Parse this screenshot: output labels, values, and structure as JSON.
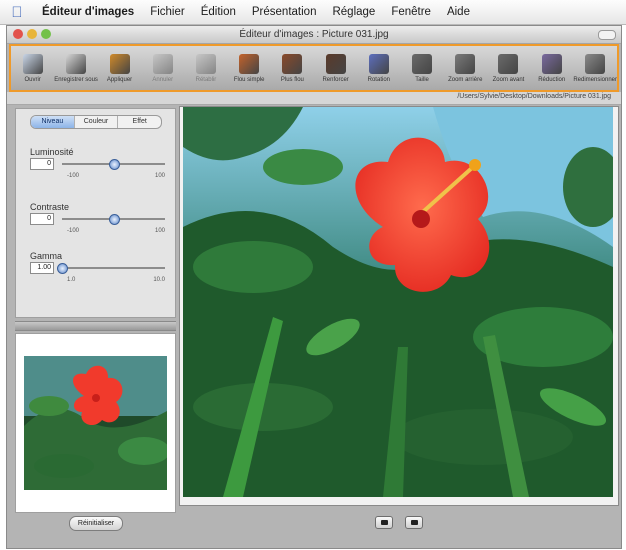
{
  "menubar": {
    "app": "Éditeur d'images",
    "items": [
      "Fichier",
      "Édition",
      "Présentation",
      "Réglage",
      "Fenêtre",
      "Aide"
    ]
  },
  "window": {
    "title": "Éditeur d'images : Picture 031.jpg"
  },
  "toolbar": [
    {
      "label": "Ouvrir",
      "icon": "open-icon",
      "enabled": true
    },
    {
      "label": "Enregistrer sous",
      "icon": "save-icon",
      "enabled": true
    },
    {
      "label": "Appliquer",
      "icon": "apply-icon",
      "enabled": true
    },
    {
      "label": "Annuler",
      "icon": "undo-icon",
      "enabled": false
    },
    {
      "label": "Rétablir",
      "icon": "redo-icon",
      "enabled": false
    },
    {
      "label": "Flou simple",
      "icon": "blur-icon",
      "enabled": true
    },
    {
      "label": "Plus flou",
      "icon": "more-blur-icon",
      "enabled": true
    },
    {
      "label": "Renforcer",
      "icon": "sharpen-icon",
      "enabled": true
    },
    {
      "label": "Rotation",
      "icon": "rotate-icon",
      "enabled": true
    },
    {
      "label": "Taille",
      "icon": "resize-icon",
      "enabled": true
    },
    {
      "label": "Zoom arrière",
      "icon": "zoom-out-icon",
      "enabled": true
    },
    {
      "label": "Zoom avant",
      "icon": "zoom-in-icon",
      "enabled": true
    },
    {
      "label": "Réduction",
      "icon": "reduce-icon",
      "enabled": true
    },
    {
      "label": "Redimensionner",
      "icon": "resize-window-icon",
      "enabled": true
    }
  ],
  "path": "/Users/Sylvie/Desktop/Downloads/Picture 031.jpg",
  "adjust": {
    "tabs": [
      "Niveau",
      "Couleur",
      "Effet"
    ],
    "active_tab": 0,
    "sliders": [
      {
        "label": "Luminosité",
        "value": "0",
        "min": "-100",
        "max": "100",
        "fraction": 0.5
      },
      {
        "label": "Contraste",
        "value": "0",
        "min": "-100",
        "max": "100",
        "fraction": 0.5
      },
      {
        "label": "Gamma",
        "value": "1.00",
        "min": "1.0",
        "max": "10.0",
        "fraction": 0.0
      }
    ]
  },
  "reset_label": "Réinitialiser",
  "colors": {
    "toolbar_highlight": "#ef9a2a",
    "flower": "#f13a2c",
    "slider_knob": "#5b86c8"
  }
}
